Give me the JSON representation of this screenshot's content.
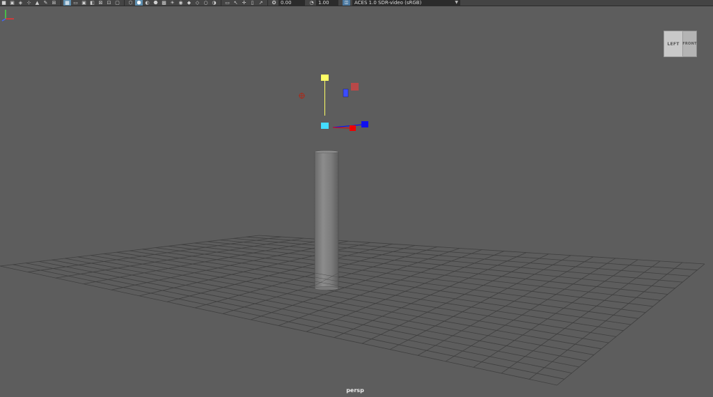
{
  "toolbar": {
    "icons": [
      {
        "name": "camera-attributes-icon",
        "glyph": "■"
      },
      {
        "name": "select-camera-icon",
        "glyph": "▣"
      },
      {
        "name": "lock-camera-icon",
        "glyph": "◈"
      },
      {
        "name": "bookmark-icon",
        "glyph": "⊹"
      },
      {
        "name": "image-plane-icon",
        "glyph": "▲"
      },
      {
        "name": "grease-pencil-icon",
        "glyph": "✎"
      },
      {
        "name": "two-d-pan-zoom-icon",
        "glyph": "⊞"
      },
      {
        "name": "grid-icon",
        "glyph": "▦",
        "active": true
      },
      {
        "name": "film-gate-icon",
        "glyph": "▭"
      },
      {
        "name": "resolution-gate-icon",
        "glyph": "▣"
      },
      {
        "name": "gate-mask-icon",
        "glyph": "◧"
      },
      {
        "name": "field-chart-icon",
        "glyph": "⊠"
      },
      {
        "name": "safe-action-icon",
        "glyph": "⊡"
      },
      {
        "name": "safe-title-icon",
        "glyph": "▢"
      },
      {
        "name": "wireframe-icon",
        "glyph": "⬡"
      },
      {
        "name": "smooth-shade-icon",
        "glyph": "⬢",
        "active": true
      },
      {
        "name": "default-material-icon",
        "glyph": "◐"
      },
      {
        "name": "shaded-wireframe-icon",
        "glyph": "⬣"
      },
      {
        "name": "textured-icon",
        "glyph": "▩"
      },
      {
        "name": "use-lights-icon",
        "glyph": "☀"
      },
      {
        "name": "shadows-icon",
        "glyph": "◉"
      },
      {
        "name": "screen-space-ao-icon",
        "glyph": "◆"
      },
      {
        "name": "motion-blur-icon",
        "glyph": "◇"
      },
      {
        "name": "anti-aliasing-icon",
        "glyph": "○"
      },
      {
        "name": "depth-of-field-icon",
        "glyph": "◑"
      },
      {
        "name": "isolate-select-icon",
        "glyph": "▭"
      },
      {
        "name": "xray-icon",
        "glyph": "↖"
      },
      {
        "name": "xray-joints-icon",
        "glyph": "✛"
      },
      {
        "name": "xray-components-icon",
        "glyph": "▯"
      },
      {
        "name": "backface-culling-icon",
        "glyph": "↗"
      }
    ],
    "exposure_value": "0.00",
    "gamma_value": "1.00",
    "color_space": "ACES 1.0 SDR-video (sRGB)"
  },
  "viewcube": {
    "left": "LEFT",
    "right": "FRONT"
  },
  "camera_name": "persp",
  "colors": {
    "viewport_bg": "#5d5d5d",
    "grid_line": "#3f3f3f",
    "manip_yellow": "#ffff66",
    "manip_cyan": "#44ddff",
    "manip_blue": "#1010ee",
    "manip_red": "#ee0000"
  }
}
